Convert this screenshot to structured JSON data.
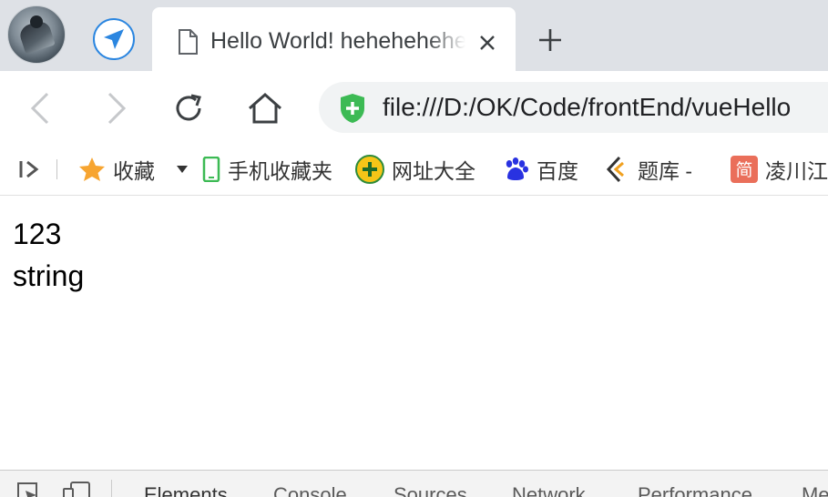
{
  "tab": {
    "title": "Hello World! hehehehehe"
  },
  "toolbar": {
    "url": "file:///D:/OK/Code/frontEnd/vueHello"
  },
  "bookmarks": {
    "favorites": "收藏",
    "items": [
      {
        "label": "手机收藏夹"
      },
      {
        "label": "网址大全"
      },
      {
        "label": "百度"
      },
      {
        "label": "题库 -"
      },
      {
        "label": "凌川江"
      }
    ]
  },
  "page": {
    "lines": [
      "123",
      "string"
    ]
  },
  "devtools": {
    "tabs": [
      "Elements",
      "Console",
      "Sources",
      "Network",
      "Performance",
      "Memory"
    ]
  },
  "colors": {
    "accent": "#2b86e0",
    "tab_strip": "#dee1e6",
    "omnibox": "#f1f3f4",
    "secure_green": "#3cba54"
  }
}
